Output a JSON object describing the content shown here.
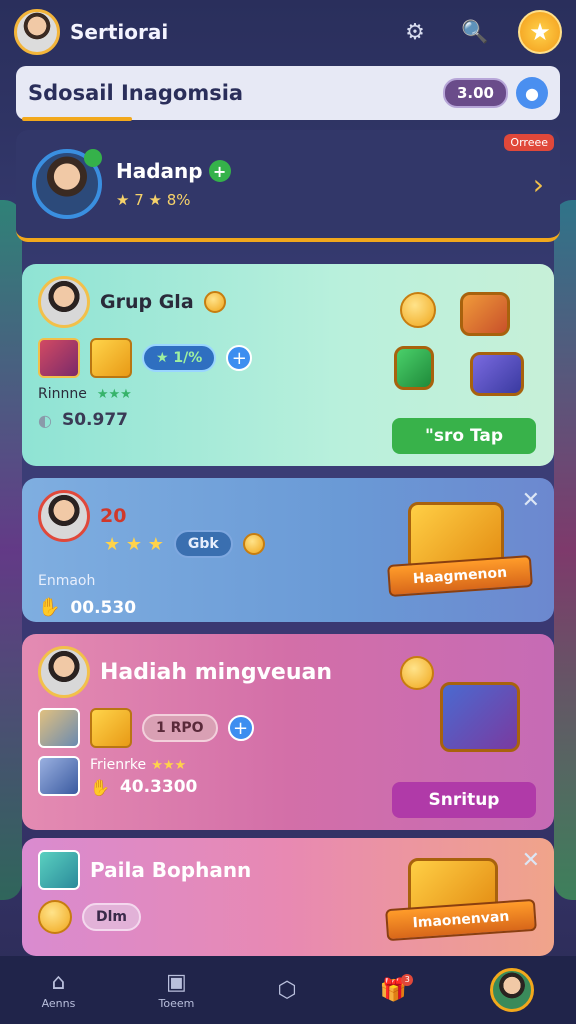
{
  "app": {
    "title": "Sertiorai"
  },
  "header": {
    "title": "Sdosail Inagomsia",
    "balance": "3.00"
  },
  "profile": {
    "name": "Hadanp",
    "stats": "★ 7 ★ 8%",
    "tag": "Orreee"
  },
  "cards": [
    {
      "title": "Grup Gla",
      "pill": "★ 1/%",
      "label": "Rinnne",
      "value": "S0.977",
      "button": "\"sro Tap"
    },
    {
      "title": "20",
      "pill": "Gbk",
      "label": "Enmaoh",
      "value": "00.530",
      "banner": "Haagmenon"
    },
    {
      "title": "Hadiah mingveuan",
      "pill": "1 RPO",
      "label": "Frienrke",
      "value": "40.3300",
      "button": "Snritup"
    },
    {
      "title": "Paila Bophann",
      "pill": "Dlm",
      "banner": "Imaonenvan"
    }
  ],
  "nav": [
    {
      "label": "Aenns",
      "icon": "home-icon"
    },
    {
      "label": "Toeem",
      "icon": "square-icon"
    },
    {
      "label": "",
      "icon": "shield-icon"
    },
    {
      "label": "",
      "icon": "gift-icon",
      "badge": "3"
    }
  ]
}
